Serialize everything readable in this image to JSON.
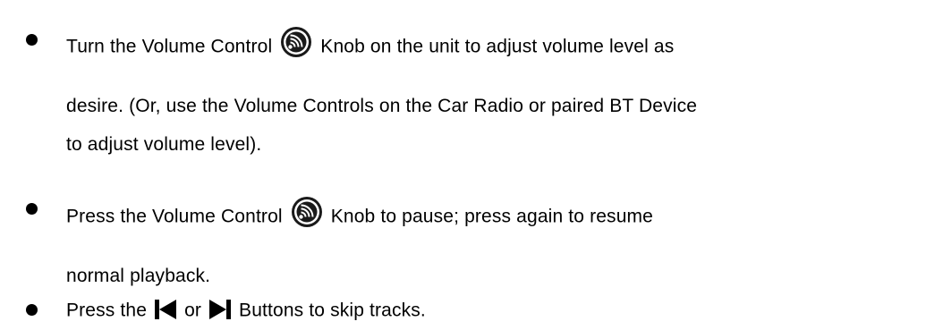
{
  "bullets": [
    {
      "lines": [
        {
          "before": "Turn the Volume Control",
          "icon": "volume-knob-icon",
          "after": "Knob on the unit to adjust volume level as"
        },
        {
          "text": "desire. (Or, use the Volume Controls on the Car Radio or paired BT Device"
        },
        {
          "text": "to adjust volume level)."
        }
      ]
    },
    {
      "lines": [
        {
          "before": "Press the Volume Control",
          "icon": "volume-knob-icon",
          "after": "Knob to pause; press again to resume"
        },
        {
          "text": "normal playback."
        }
      ]
    },
    {
      "lines": [
        {
          "before": "Press the",
          "icon": "previous-track-icon",
          "middle": "or",
          "icon2": "next-track-icon",
          "after": "Buttons to skip tracks."
        }
      ]
    }
  ]
}
